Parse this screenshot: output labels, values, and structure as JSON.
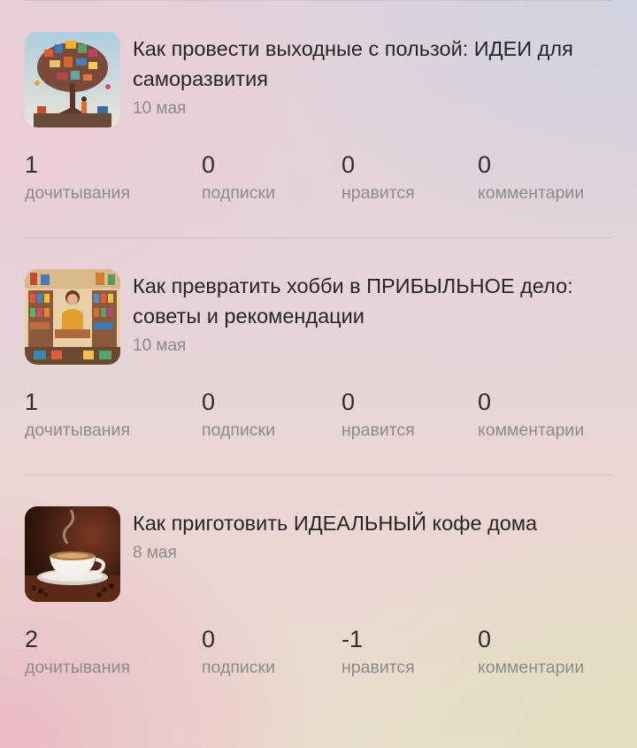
{
  "articles": [
    {
      "title": "Как провести выходные с пользой: ИДЕИ для саморазвития",
      "date": "10 мая",
      "thumbnail": "tree-books-illustration",
      "stats": [
        {
          "value": "1",
          "label": "дочитывания"
        },
        {
          "value": "0",
          "label": "подписки"
        },
        {
          "value": "0",
          "label": "нравится"
        },
        {
          "value": "0",
          "label": "комментарии"
        }
      ]
    },
    {
      "title": "Как превратить хобби в ПРИБЫЛЬНОЕ дело: советы и рекомендации",
      "date": "10 мая",
      "thumbnail": "hobby-shop-illustration",
      "stats": [
        {
          "value": "1",
          "label": "дочитывания"
        },
        {
          "value": "0",
          "label": "подписки"
        },
        {
          "value": "0",
          "label": "нравится"
        },
        {
          "value": "0",
          "label": "комментарии"
        }
      ]
    },
    {
      "title": "Как приготовить ИДЕАЛЬНЫЙ кофе дома",
      "date": "8 мая",
      "thumbnail": "coffee-cup-photo",
      "stats": [
        {
          "value": "2",
          "label": "дочитывания"
        },
        {
          "value": "0",
          "label": "подписки"
        },
        {
          "value": "-1",
          "label": "нравится"
        },
        {
          "value": "0",
          "label": "комментарии"
        }
      ]
    }
  ]
}
